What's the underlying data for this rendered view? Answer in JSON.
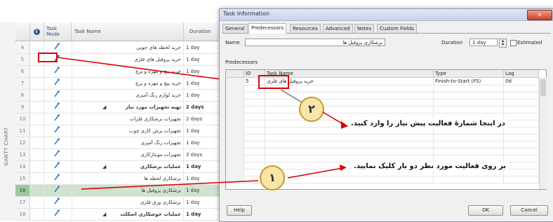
{
  "gantt": {
    "side_label": "GANTT CHART",
    "columns": {
      "mode": "Task Mode",
      "name": "Task Name",
      "duration": "Duration"
    },
    "rows": [
      {
        "id": "4",
        "name": "خرید لحظه های چوبی",
        "duration": "1 day",
        "bold": false,
        "selected": false
      },
      {
        "id": "5",
        "name": "خرید پروفیل های فلزی",
        "duration": "1 day",
        "bold": false,
        "selected": false
      },
      {
        "id": "6",
        "name": "خرید پیچ و مهره و پرچ",
        "duration": "1 day",
        "bold": false,
        "selected": false
      },
      {
        "id": "7",
        "name": "خرید پیچ و مهره و پرچ",
        "duration": "1 day",
        "bold": false,
        "selected": false
      },
      {
        "id": "8",
        "name": "خرید لوازم رنگ آمیزی",
        "duration": "1 day",
        "bold": false,
        "selected": false
      },
      {
        "id": "9",
        "name": "تهیه تجهیزات مورد نیاز",
        "duration": "2 days",
        "bold": true,
        "selected": false
      },
      {
        "id": "10",
        "name": "تجهیزات برشکاری فلزات",
        "duration": "2 days",
        "bold": false,
        "selected": false
      },
      {
        "id": "11",
        "name": "تجهیزات برش کاری چوب",
        "duration": "1 day",
        "bold": false,
        "selected": false
      },
      {
        "id": "12",
        "name": "تجهیزات رنگ آمیزی",
        "duration": "1 day",
        "bold": false,
        "selected": false
      },
      {
        "id": "13",
        "name": "تجهیزات مونتاژکاری",
        "duration": "2 days",
        "bold": false,
        "selected": false
      },
      {
        "id": "14",
        "name": "عملیات برشکاری",
        "duration": "1 day",
        "bold": true,
        "selected": false
      },
      {
        "id": "15",
        "name": "برشکاری لحظه ها",
        "duration": "1 day",
        "bold": false,
        "selected": false
      },
      {
        "id": "16",
        "name": "برشکاری پروفیل ها",
        "duration": "1 day",
        "bold": false,
        "selected": true
      },
      {
        "id": "17",
        "name": "برشکاری ورق فلزی",
        "duration": "1 day",
        "bold": false,
        "selected": false
      },
      {
        "id": "18",
        "name": "عملیات جوشکاری اسکلت",
        "duration": "1 day",
        "bold": true,
        "selected": false
      }
    ]
  },
  "dialog": {
    "title": "Task Information",
    "tabs": [
      "General",
      "Predecessors",
      "Resources",
      "Advanced",
      "Notes",
      "Custom Fields"
    ],
    "active_tab": 1,
    "name_label": "Name",
    "name_value": "برشکاری پروفیل ها",
    "duration_label": "Duration",
    "duration_value": "1 day",
    "estimated_label": "Estimated",
    "predecessors_label": "Predecessors",
    "table_headers": {
      "id": "ID",
      "task_name": "Task Name",
      "type": "Type",
      "lag": "Lag"
    },
    "pred_rows": [
      {
        "id": "5",
        "task_name": "خرید پروفیل های فلزی",
        "type": "Finish-to-Start (FS)",
        "lag": "0d"
      }
    ],
    "help_button": "Help",
    "ok_button": "OK",
    "cancel_button": "Cancel"
  },
  "callouts": {
    "step2_number": "۲",
    "step2_text": "در اینجا شمارهٔ فعالیت پیش نیاز را وارد کنید.",
    "step1_number": "۱",
    "step1_text": "بر روی فعالیت مورد نظر دو بار کلیک نمایید."
  },
  "colors": {
    "annotation_red": "#dd0000",
    "circle_fill": "#f7e6a8",
    "selected_row": "#cfe3cf"
  }
}
